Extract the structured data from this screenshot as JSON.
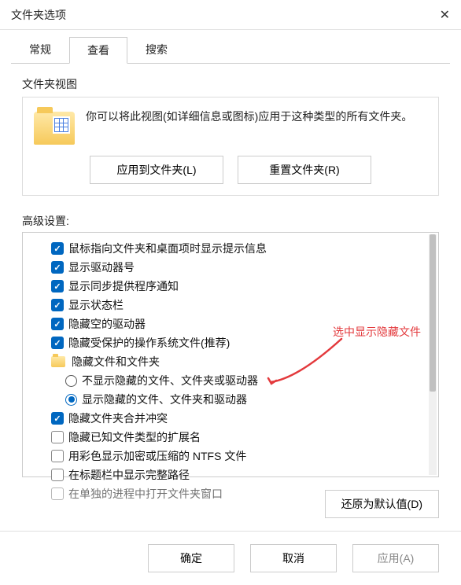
{
  "window": {
    "title": "文件夹选项"
  },
  "tabs": {
    "general": "常规",
    "view": "查看",
    "search": "搜索"
  },
  "folder_view": {
    "group_title": "文件夹视图",
    "description": "你可以将此视图(如详细信息或图标)应用于这种类型的所有文件夹。",
    "apply_btn": "应用到文件夹(L)",
    "reset_btn": "重置文件夹(R)"
  },
  "advanced": {
    "label": "高级设置:",
    "items": [
      {
        "checked": true,
        "text": "鼠标指向文件夹和桌面项时显示提示信息"
      },
      {
        "checked": true,
        "text": "显示驱动器号"
      },
      {
        "checked": true,
        "text": "显示同步提供程序通知"
      },
      {
        "checked": true,
        "text": "显示状态栏"
      },
      {
        "checked": true,
        "text": "隐藏空的驱动器"
      },
      {
        "checked": true,
        "text": "隐藏受保护的操作系统文件(推荐)"
      }
    ],
    "hidden_group": "隐藏文件和文件夹",
    "radio_hide": "不显示隐藏的文件、文件夹或驱动器",
    "radio_show": "显示隐藏的文件、文件夹和驱动器",
    "tail": [
      {
        "checked": true,
        "text": "隐藏文件夹合并冲突"
      },
      {
        "checked": false,
        "text": "隐藏已知文件类型的扩展名"
      },
      {
        "checked": false,
        "text": "用彩色显示加密或压缩的 NTFS 文件"
      },
      {
        "checked": false,
        "text": "在标题栏中显示完整路径"
      },
      {
        "checked": false,
        "text": "在单独的进程中打开文件夹窗口"
      }
    ],
    "restore_btn": "还原为默认值(D)"
  },
  "annotation": {
    "text": "选中显示隐藏文件"
  },
  "footer": {
    "ok": "确定",
    "cancel": "取消",
    "apply": "应用(A)"
  }
}
